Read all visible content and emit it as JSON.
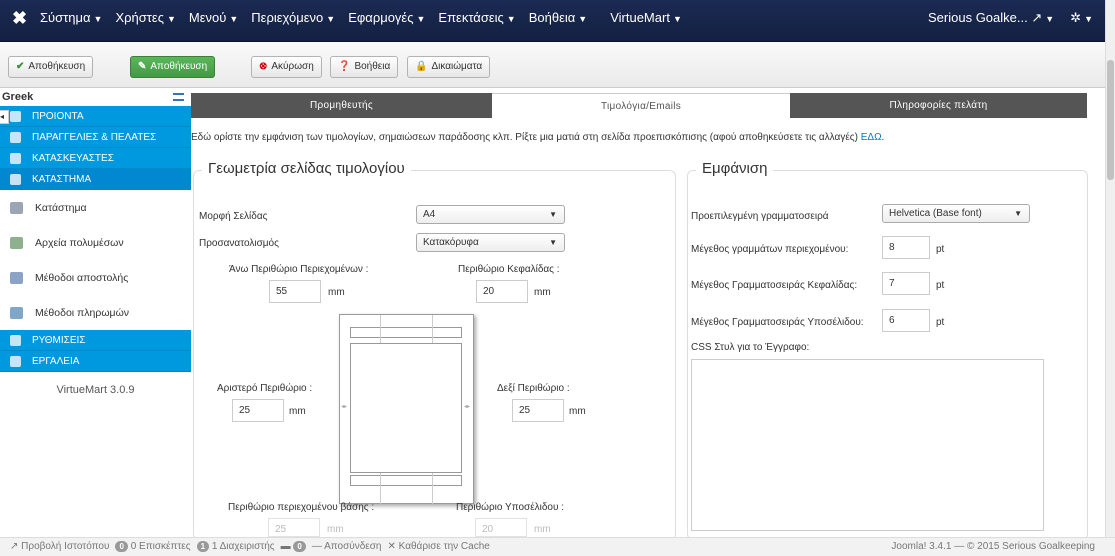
{
  "nav": {
    "menu": [
      "Σύστημα",
      "Χρήστες",
      "Μενού",
      "Περιεχόμενο",
      "Εφαρμογές",
      "Επεκτάσεις",
      "Βοήθεια",
      "VirtueMart"
    ],
    "user": "Serious Goalke...",
    "colors": {
      "bar": "#1b2a52",
      "accent": "#0099e0",
      "green": "#5bb75b"
    }
  },
  "toolbar": {
    "save": "Αποθήκευση",
    "save_close": "Αποθήκευση",
    "cancel": "Ακύρωση",
    "help": "Βοήθεια",
    "permissions": "Δικαιώματα"
  },
  "sidebar": {
    "lang": "Greek",
    "top_items": [
      "ΠΡΟΙΟΝΤΑ",
      "ΠΑΡΑΓΓΕΛΙΕΣ & ΠΕΛΑΤΕΣ",
      "ΚΑΤΑΣΚΕΥΑΣΤΕΣ",
      "ΚΑΤΑΣΤΗΜΑ"
    ],
    "sub_items": [
      "Κατάστημα",
      "Αρχεία πολυμέσων",
      "Μέθοδοι αποστολής",
      "Μέθοδοι πληρωμών"
    ],
    "bottom_items": [
      "ΡΥΘΜΙΣΕΙΣ",
      "ΕΡΓΑΛΕΙΑ"
    ],
    "version": "VirtueMart 3.0.9"
  },
  "tabs": [
    "Προμηθευτής",
    "Τιμολόγια/Emails",
    "Πληροφορίες πελάτη"
  ],
  "intro": {
    "text": "Εδώ ορίστε την εμφάνιση των τιμολογίων, σημαιώσεων παράδοσης κλπ. Ρίξτε μια ματιά στη σελίδα προεπισκόπισης (αφού αποθηκεύσετε τις αλλαγές)",
    "link": "ΕΔΩ",
    "dot": "."
  },
  "geometry": {
    "title": "Γεωμετρία σελίδας τιμολογίου",
    "page_format_label": "Μορφή Σελίδας",
    "page_format": "A4",
    "orientation_label": "Προσανατολισμός",
    "orientation": "Κατακόρυφα",
    "top_margin_label": "Άνω Περιθώριο Περιεχομένων :",
    "top_margin": "55",
    "header_margin_label": "Περιθώριο Κεφαλίδας :",
    "header_margin": "20",
    "left_margin_label": "Αριστερό Περιθώριο :",
    "left_margin": "25",
    "right_margin_label": "Δεξί Περιθώριο :",
    "right_margin": "25",
    "bottom_margin_label": "Περιθώριο περιεχομένου βάσης :",
    "bottom_margin": "25",
    "footer_margin_label": "Περιθώριο Υποσέλιδου :",
    "footer_margin": "20",
    "unit": "mm"
  },
  "appearance": {
    "title": "Εμφάνιση",
    "font_label": "Προεπιλεγμένη γραμματοσειρά",
    "font": "Helvetica (Base font)",
    "content_size_label": "Μέγεθος γραμμάτων περιεχομένου:",
    "content_size": "8",
    "header_size_label": "Μέγεθος Γραμματοσειράς Κεφαλίδας:",
    "header_size": "7",
    "footer_size_label": "Μέγεθος Γραμματοσειράς Υποσέλιδου:",
    "footer_size": "6",
    "pt": "pt",
    "css_label": "CSS Στυλ για το Έγγραφο:"
  },
  "footer": {
    "view_site": "Προβολή Ιστοτόπου",
    "visitors_count": "0",
    "visitors": "0 Επισκέπτες",
    "admins_count": "1",
    "admins": "1 Διαχειριστής",
    "messages_count": "0",
    "logout": "Αποσύνδεση",
    "clear_cache": "Καθάρισε την Cache",
    "copyright": "Joomla! 3.4.1 — © 2015 Serious Goalkeeping"
  }
}
